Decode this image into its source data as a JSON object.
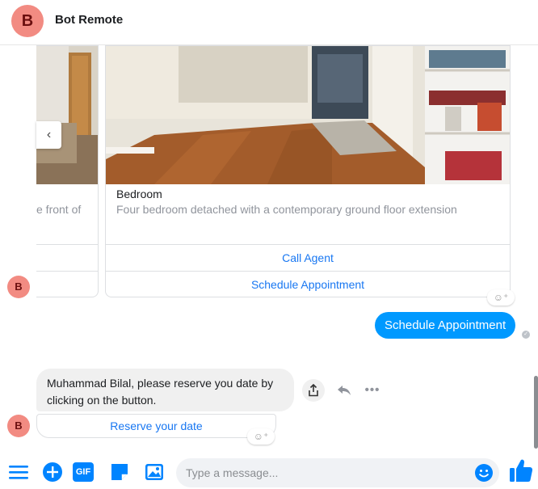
{
  "header": {
    "avatar_letter": "B",
    "title": "Bot Remote"
  },
  "carousel": {
    "prev_card": {
      "subtitle": "e front of"
    },
    "main_card": {
      "title": "Bedroom",
      "subtitle": "Four bedroom detached with a contemporary ground floor extension",
      "buttons": [
        "Call Agent",
        "Schedule Appointment"
      ]
    },
    "prev_arrow": "‹"
  },
  "bot_avatar_letter": "B",
  "user_message": "Schedule Appointment",
  "bot_message": "Muhammad Bilal, please reserve you date by clicking on the button.",
  "bot_button": "Reserve your date",
  "composer": {
    "placeholder": "Type a message...",
    "gif_label": "GIF"
  },
  "colors": {
    "accent": "#0084ff",
    "user_bubble": "#0099ff",
    "link_blue": "#1877f2",
    "avatar_bg": "#f28b82",
    "bot_bubble": "#f0f0f0"
  },
  "icons": [
    "menu-icon",
    "plus-icon",
    "gif-icon",
    "sticker-icon",
    "image-icon",
    "emoji-icon",
    "like-icon",
    "share-icon",
    "reply-icon",
    "more-icon",
    "chevron-left-icon",
    "add-reaction-icon"
  ]
}
